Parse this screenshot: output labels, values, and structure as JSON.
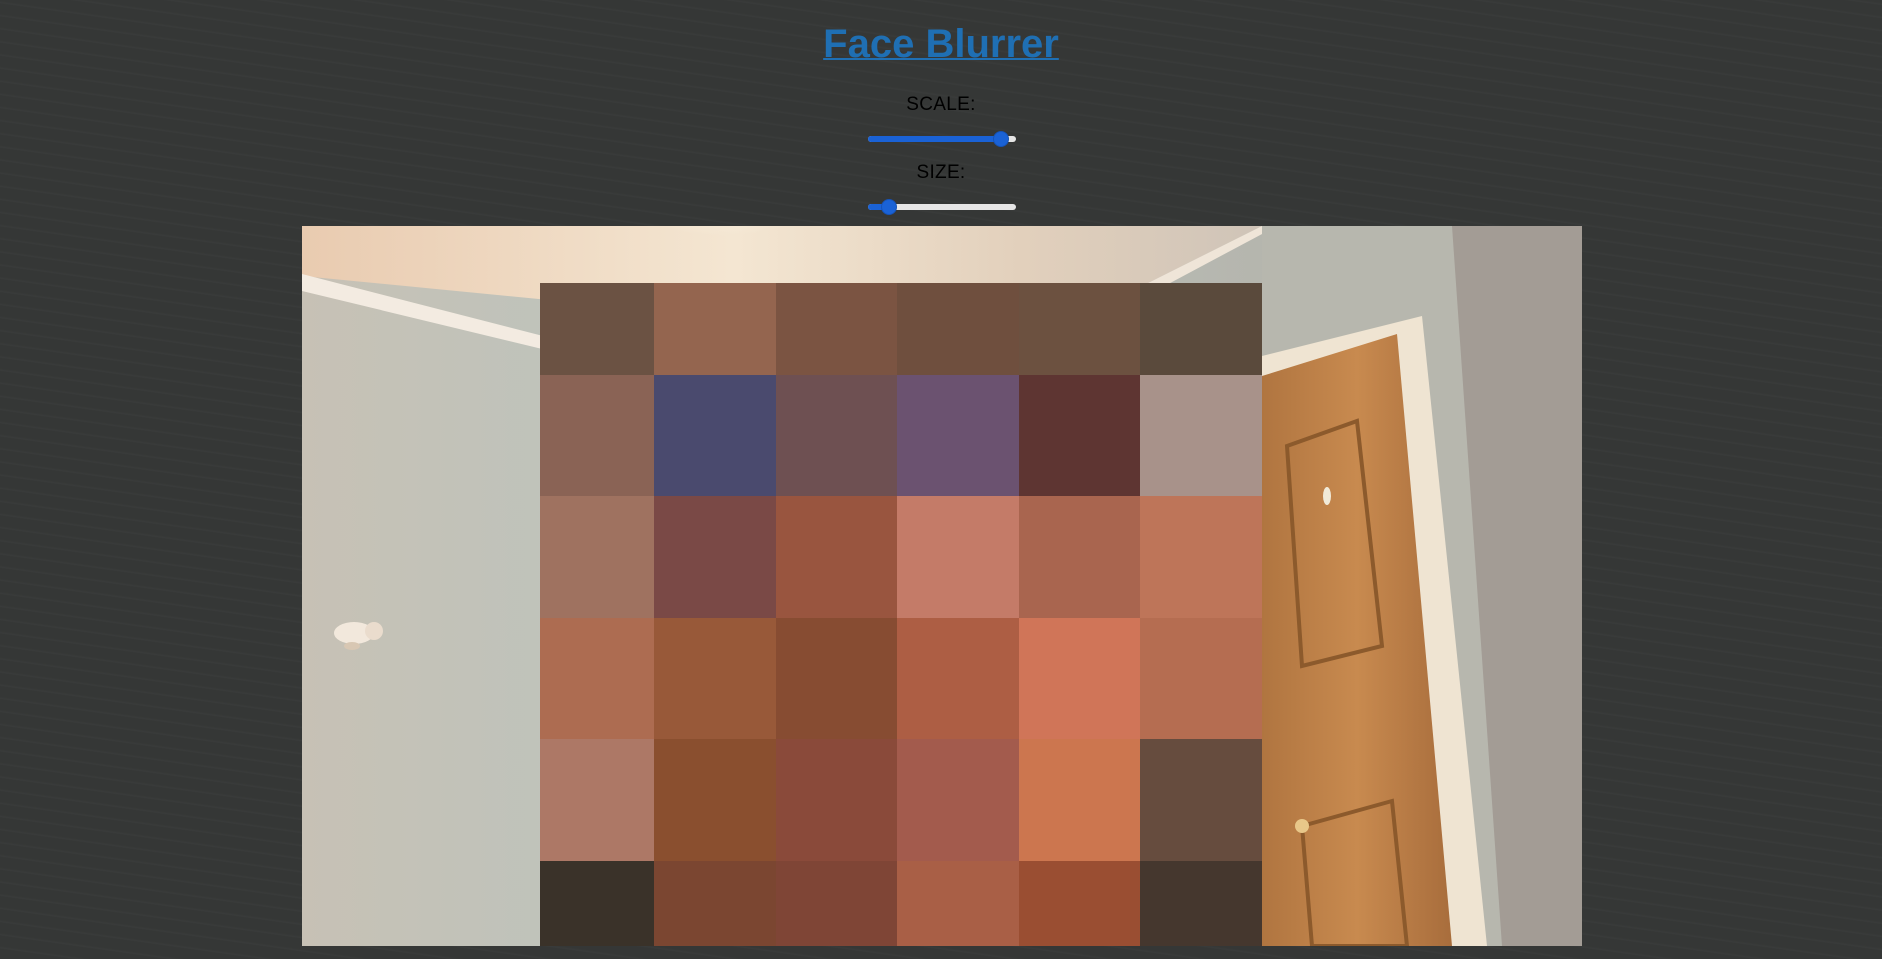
{
  "app": {
    "title": "Face Blurrer"
  },
  "controls": {
    "scale": {
      "label": "SCALE:",
      "value_fraction": 0.9
    },
    "size": {
      "label": "SIZE:",
      "value_fraction": 0.14
    }
  },
  "colors": {
    "background": "#353736",
    "title_link": "#1f6fb3",
    "slider_accent": "#1a62d6",
    "slider_track": "#e6e6e6"
  },
  "pixelation": {
    "col_widths": [
      114,
      122,
      121,
      122,
      121,
      122
    ],
    "row_heights": [
      92,
      121,
      122,
      121,
      122,
      85
    ],
    "cells": [
      [
        "#6b5243",
        "#94654f",
        "#7b5442",
        "#6f4f3e",
        "#6c5140",
        "#5a4a3c"
      ],
      [
        "#8a6355",
        "#4a4a6e",
        "#6e5052",
        "#6b5270",
        "#5e3532",
        "#a8928a"
      ],
      [
        "#9f7260",
        "#7a4946",
        "#99553f",
        "#c47b68",
        "#a9654f",
        "#be7559"
      ],
      [
        "#ad6c51",
        "#985939",
        "#874c32",
        "#ad5e44",
        "#d07558",
        "#b56d51"
      ],
      [
        "#ad7866",
        "#8a4f2f",
        "#8a4a3a",
        "#a35b4d",
        "#cc764f",
        "#664c3e"
      ],
      [
        "#3a3229",
        "#7b4631",
        "#7f4536",
        "#a95f46",
        "#9a4e32",
        "#45372e"
      ]
    ]
  }
}
